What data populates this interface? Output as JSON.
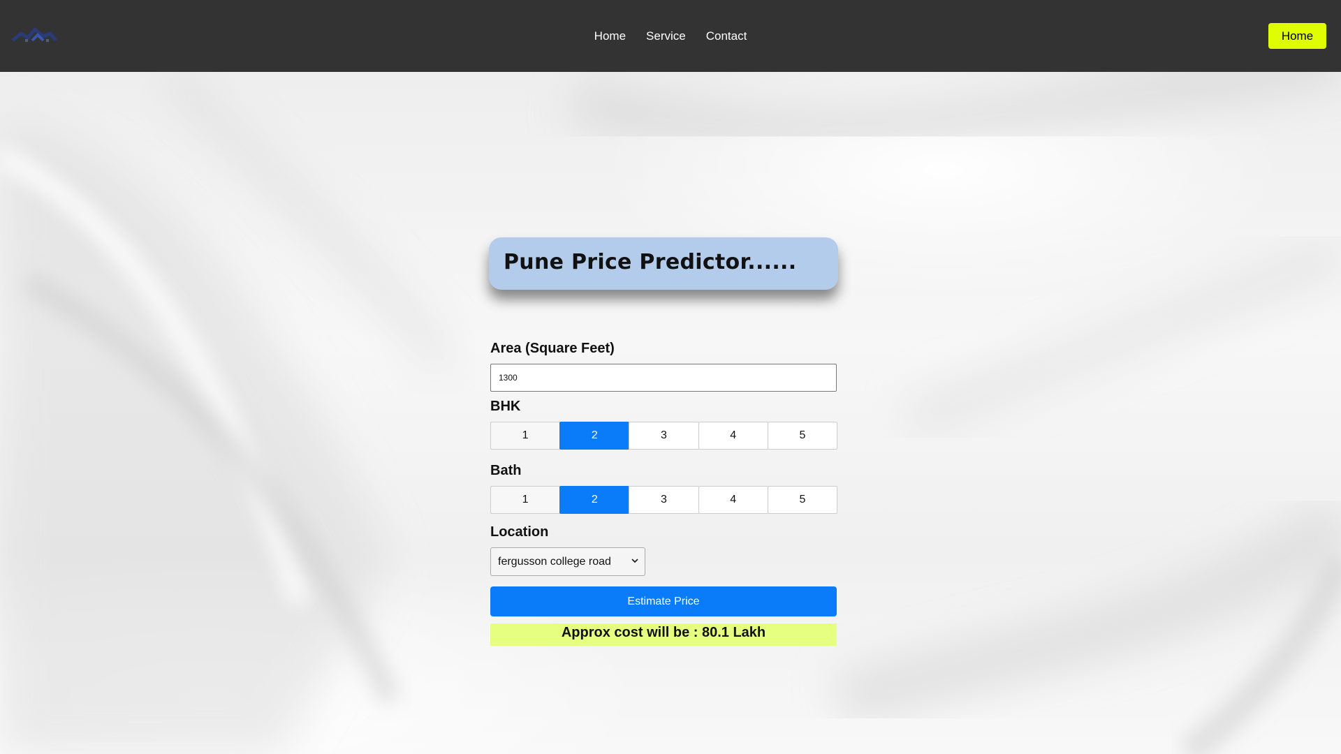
{
  "nav": {
    "logo_icon": "house-roof-logo-icon",
    "links": [
      "Home",
      "Service",
      "Contact"
    ],
    "cta_label": "Home",
    "cta_color": "#dfff00",
    "bar_color": "#333333"
  },
  "card": {
    "title": "Pune Price Predictor......"
  },
  "form": {
    "area_label": "Area (Square Feet)",
    "area_value": "1300",
    "bhk_label": "BHK",
    "bhk_options": [
      "1",
      "2",
      "3",
      "4",
      "5"
    ],
    "bhk_selected": "2",
    "bath_label": "Bath",
    "bath_options": [
      "1",
      "2",
      "3",
      "4",
      "5"
    ],
    "bath_selected": "2",
    "location_label": "Location",
    "location_value": "fergusson college road",
    "estimate_label": "Estimate Price",
    "result_text": "Approx cost will be : 80.1 Lakh",
    "accent_color": "#0a7cf9",
    "result_color": "#e6ff80"
  }
}
